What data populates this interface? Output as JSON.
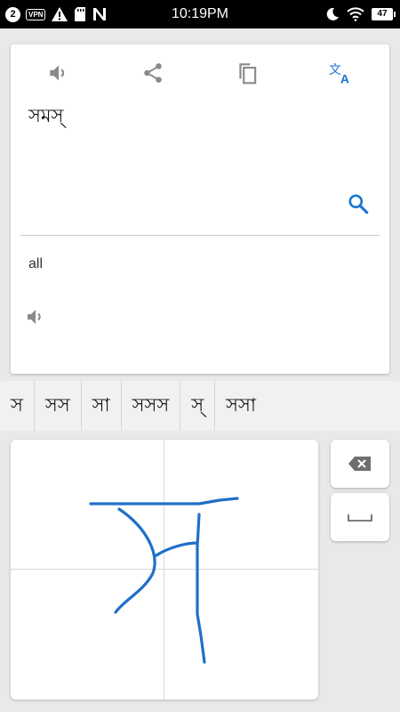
{
  "status_bar": {
    "notification_count": "2",
    "vpn_label": "VPN",
    "time": "10:19PM",
    "battery": "47",
    "icons": [
      "notification-count",
      "vpn-icon",
      "warning-icon",
      "sd-card-icon",
      "n-logo-icon",
      "moon-icon",
      "wifi-icon",
      "battery-icon"
    ]
  },
  "toolbar": {
    "icons": [
      "speaker-icon",
      "share-icon",
      "copy-icon",
      "translate-icon"
    ],
    "accent_color": "#1976d2",
    "icon_color": "#8a8a8a"
  },
  "source": {
    "text": "সমস্"
  },
  "result": {
    "text": "all"
  },
  "suggestions": [
    "স",
    "সস",
    "সা",
    "সসস",
    "স্",
    "সসা"
  ],
  "handwriting": {
    "stroke_color": "#1f6fc9",
    "backspace_icon": "backspace-icon",
    "space_icon": "space-icon"
  }
}
